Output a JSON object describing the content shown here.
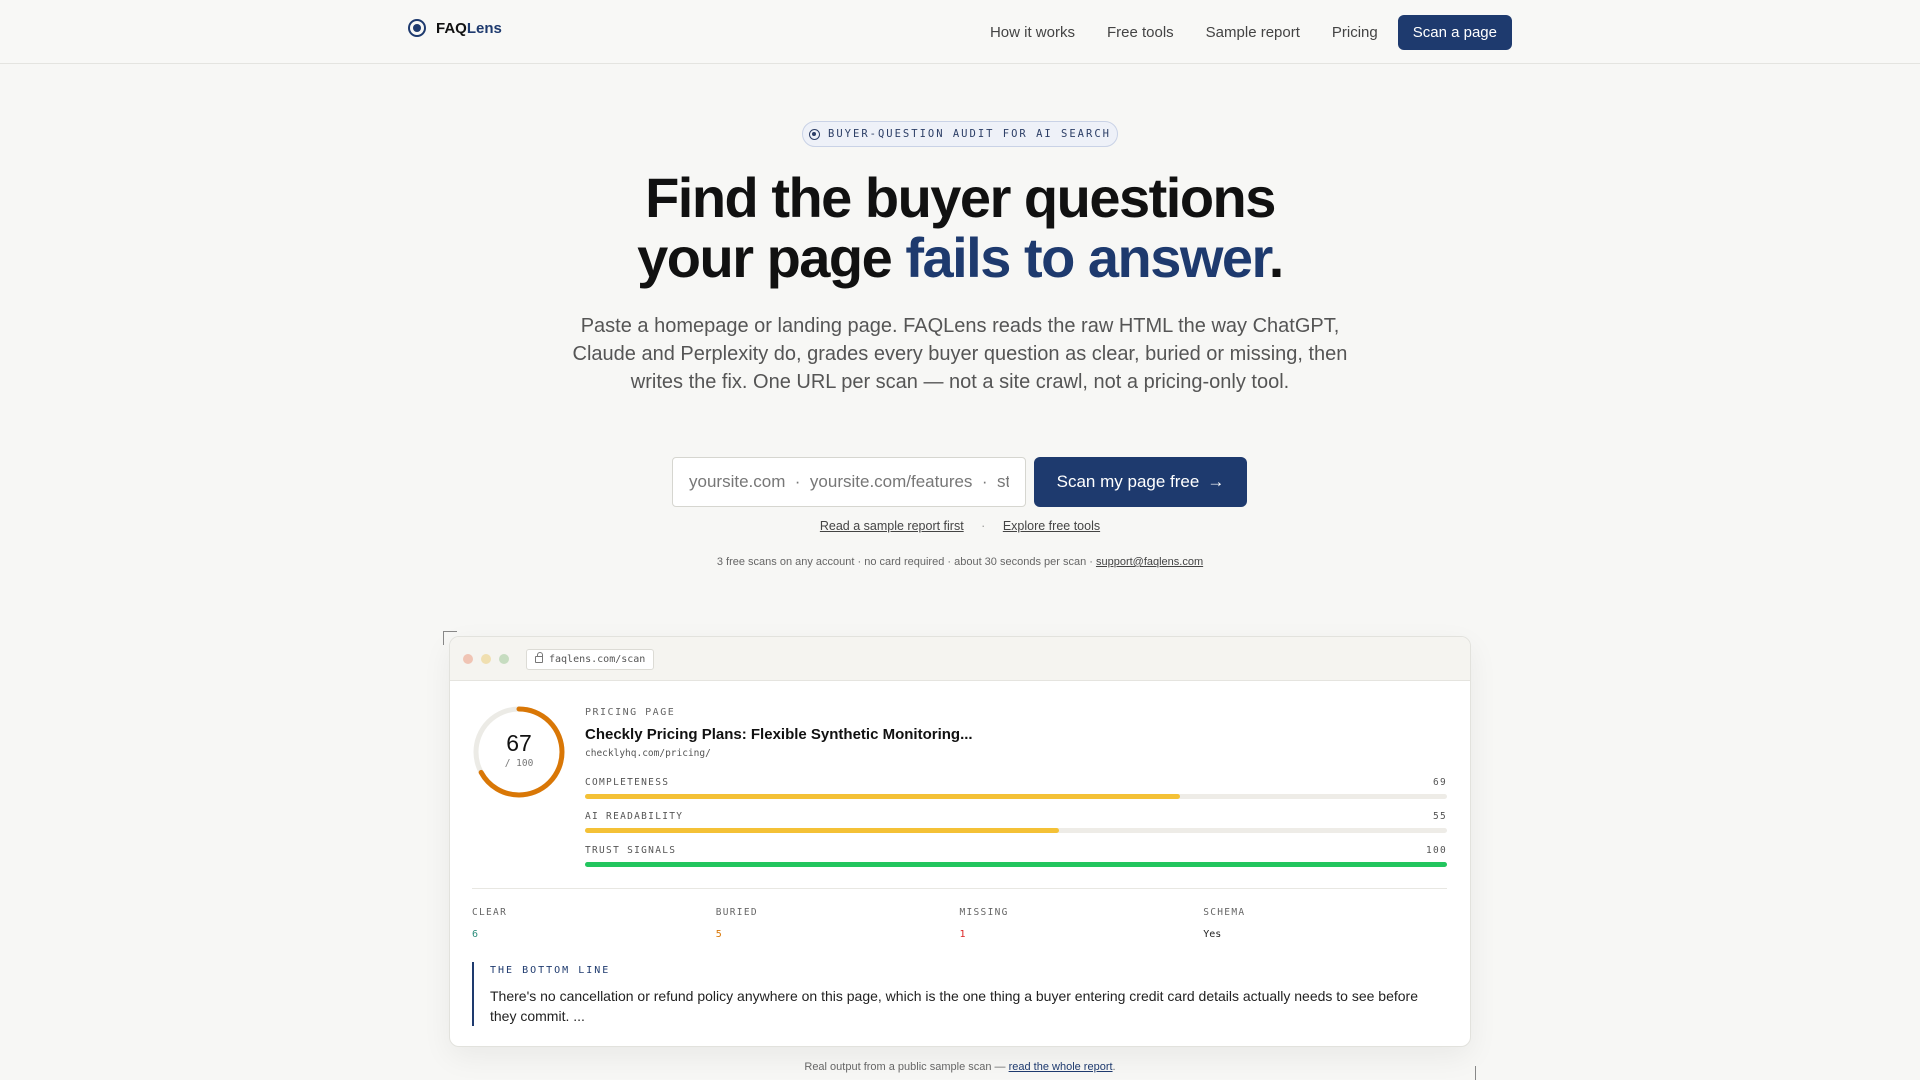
{
  "nav": {
    "brand_name_a": "FAQ",
    "brand_name_b": "Lens",
    "links": [
      "How it works",
      "Free tools",
      "Sample report",
      "Pricing"
    ],
    "cta": "Scan a page"
  },
  "hero": {
    "badge": "BUYER-QUESTION AUDIT FOR AI SEARCH",
    "headline_line1": "Find the buyer questions",
    "headline_line2_a": "your page ",
    "headline_line2_accent": "fails to answer",
    "headline_line2_end": ".",
    "sub": "Paste a homepage or landing page. FAQLens reads the raw HTML the way ChatGPT, Claude and Perplexity do, grades every buyer question as clear, buried or missing, then writes the fix. One URL per scan — not a site crawl, not a pricing-only tool.",
    "input_placeholder": "yoursite.com  ·  yoursite.com/features  ·  store.yoursite.com",
    "scan_button": "Scan my page free",
    "link_sample": "Read a sample report first",
    "link_sep": "·",
    "link_tools": "Explore free tools",
    "fineprint": "3 free scans on any account · no card required · about 30 seconds per scan · ",
    "support_email": "support@faqlens.com"
  },
  "report": {
    "url": "faqlens.com/scan",
    "score": "67",
    "score_value": 67,
    "score_max": "/ 100",
    "page_type": "PRICING PAGE",
    "page_title": "Checkly Pricing Plans: Flexible Synthetic Monitoring...",
    "page_url": "checklyhq.com/pricing/",
    "metrics": [
      {
        "label": "COMPLETENESS",
        "value": "69",
        "pct": 69,
        "color": "#f4c136"
      },
      {
        "label": "AI READABILITY",
        "value": "55",
        "pct": 55,
        "color": "#f4c136"
      },
      {
        "label": "TRUST SIGNALS",
        "value": "100",
        "pct": 100,
        "color": "#22c55e"
      }
    ],
    "counts": [
      {
        "label": "CLEAR",
        "value": "6",
        "color": "#2a8c7a"
      },
      {
        "label": "BURIED",
        "value": "5",
        "color": "#d97706"
      },
      {
        "label": "MISSING",
        "value": "1",
        "color": "#dc2626"
      },
      {
        "label": "SCHEMA",
        "value": "Yes",
        "color": "#222222"
      }
    ],
    "bottom_line_title": "THE BOTTOM LINE",
    "bottom_line_text": "There's no cancellation or refund policy anywhere on this page, which is the one thing a buyer entering credit card details actually needs to see before they commit. ..."
  },
  "caption": {
    "text": "Real output from a public sample scan — ",
    "link": "read the whole report",
    "end": "."
  },
  "colors": {
    "accent": "#1e3a6e",
    "gauge": "#d97706"
  }
}
